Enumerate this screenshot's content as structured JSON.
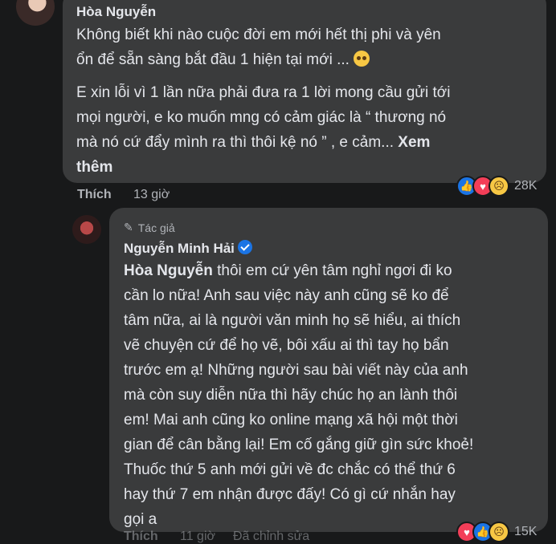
{
  "comment1": {
    "author": "Hòa Nguyễn",
    "para1_line1": "Không biết khi nào cuộc đời em mới hết thị phi và yên",
    "para1_line2": "ổn để sẵn sàng bắt đầu 1 hiện tại mới ...",
    "para1_emoji": "pleading-face-emoji",
    "para2_line1": "E xin lỗi vì 1 lần nữa phải đưa ra 1 lời mong cầu gửi tới",
    "para2_line2": "mọi người, e ko muốn mng có cảm giác là “ thương nó",
    "para2_line3": "mà nó cứ đẩy mình ra thì thôi kệ nó ” , e cảm...",
    "see_more_a": "Xem",
    "see_more_b": "thêm",
    "like_label": "Thích",
    "time": "13 giờ",
    "reaction_count": "28K",
    "reactions": [
      "like",
      "love",
      "sad"
    ]
  },
  "reply1": {
    "author_tag": "Tác giả",
    "author": "Nguyễn Minh Hải",
    "mention": "Hòa Nguyễn",
    "lines": [
      " thôi em cứ yên tâm nghỉ ngơi đi ko",
      "cần lo nữa! Anh sau việc này anh cũng sẽ ko để",
      "tâm nữa, ai là người văn minh họ sẽ hiểu, ai thích",
      "vẽ chuyện cứ để họ vẽ, bôi xấu ai thì tay họ bẩn",
      "trước em ạ! Những người sau bài viết này của anh",
      "mà còn suy diễn nữa thì hãy chúc họ an lành thôi",
      "em! Mai anh cũng ko online mạng xã hội một thời",
      "gian để cân bằng lại! Em cố gắng giữ gìn sức khoẻ!",
      "Thuốc thứ 5 anh mới gửi về đc chắc có thể thứ 6",
      "hay thứ 7 em nhận được đấy! Có gì cứ nhắn hay",
      "gọi a"
    ],
    "like_label": "Thích",
    "time": "11 giờ",
    "edited": "Đã chỉnh sửa",
    "reaction_count": "15K",
    "reactions": [
      "love",
      "like",
      "sad"
    ]
  }
}
